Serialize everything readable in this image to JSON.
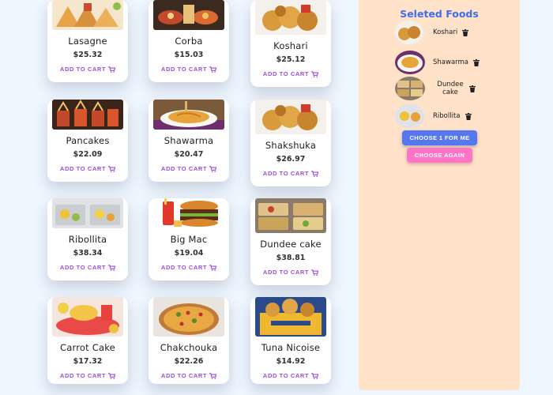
{
  "foods": [
    {
      "name": "Lasagne",
      "price": "$25.32",
      "add_label": "ADD TO CART"
    },
    {
      "name": "Corba",
      "price": "$15.03",
      "add_label": "ADD TO CART"
    },
    {
      "name": "Koshari",
      "price": "$25.12",
      "add_label": "ADD TO CART"
    },
    {
      "name": "Pancakes",
      "price": "$22.09",
      "add_label": "ADD TO CART"
    },
    {
      "name": "Shawarma",
      "price": "$20.47",
      "add_label": "ADD TO CART"
    },
    {
      "name": "Shakshuka",
      "price": "$26.97",
      "add_label": "ADD TO CART"
    },
    {
      "name": "Ribollita",
      "price": "$38.34",
      "add_label": "ADD TO CART"
    },
    {
      "name": "Big Mac",
      "price": "$19.04",
      "add_label": "ADD TO CART"
    },
    {
      "name": "Dundee cake",
      "price": "$38.81",
      "add_label": "ADD TO CART"
    },
    {
      "name": "Carrot Cake",
      "price": "$17.32",
      "add_label": "ADD TO CART"
    },
    {
      "name": "Chakchouka",
      "price": "$22.26",
      "add_label": "ADD TO CART"
    },
    {
      "name": "Tuna Nicoise",
      "price": "$14.92",
      "add_label": "ADD TO CART"
    }
  ],
  "panel": {
    "title": "Seleted Foods",
    "items": [
      {
        "name": "Koshari"
      },
      {
        "name": "Shawarma"
      },
      {
        "name": "Dundee cake"
      },
      {
        "name": "Ribollita"
      }
    ],
    "choose_label": "CHOOSE 1 FOR ME",
    "again_label": "CHOOSE AGAIN"
  },
  "icons": {
    "cart": "cart-icon",
    "trash": "trash-icon"
  },
  "colors": {
    "page_bg": "#eef6ff",
    "panel_bg": "#ffe2c7",
    "panel_title": "#3c6ff0",
    "add_to_cart": "#9b4dd9",
    "choose_button": "#5677f0",
    "again_button": "#ff74c5"
  }
}
